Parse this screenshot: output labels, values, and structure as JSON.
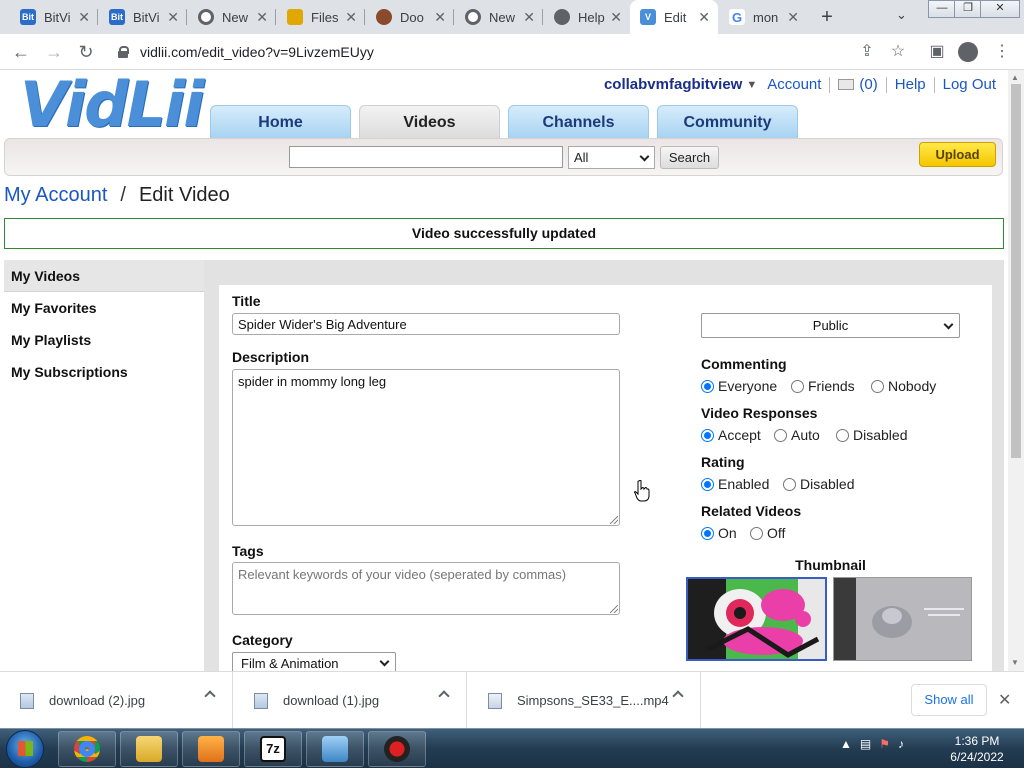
{
  "browser": {
    "tabs": [
      {
        "label": "BitVi",
        "favicon": "bitview-icon",
        "color": "#2a6cc9"
      },
      {
        "label": "BitVi",
        "favicon": "bitview-icon",
        "color": "#2a6cc9"
      },
      {
        "label": "New",
        "favicon": "chrome-icon",
        "color": "#5f6368"
      },
      {
        "label": "Files",
        "favicon": "folder-icon",
        "color": "#e0a800"
      },
      {
        "label": "Doo",
        "favicon": "avatar-icon",
        "color": "#8b4a2b"
      },
      {
        "label": "New",
        "favicon": "chrome-icon",
        "color": "#5f6368"
      },
      {
        "label": "Help",
        "favicon": "globe-icon",
        "color": "#5f6368"
      },
      {
        "label": "Edit",
        "favicon": "vidlii-icon",
        "color": "#4a8fd8",
        "active": true
      },
      {
        "label": "mon",
        "favicon": "google-icon",
        "color": "#4285f4"
      }
    ],
    "url": "vidlii.com/edit_video?v=9LivzemEUyy"
  },
  "site": {
    "logo": "VidLii",
    "user": {
      "username": "collabvmfagbitview",
      "account_label": "Account",
      "inbox_count": "(0)",
      "help_label": "Help",
      "logout_label": "Log Out"
    },
    "nav": [
      {
        "label": "Home"
      },
      {
        "label": "Videos",
        "active": true
      },
      {
        "label": "Channels"
      },
      {
        "label": "Community"
      }
    ],
    "search": {
      "value": "",
      "category": "All",
      "button_label": "Search"
    },
    "upload_label": "Upload"
  },
  "breadcrumb": {
    "root": "My Account",
    "separator": "/",
    "current": "Edit Video"
  },
  "notice": "Video successfully updated",
  "sidebar": {
    "items": [
      {
        "label": "My Videos",
        "active": true
      },
      {
        "label": "My Favorites"
      },
      {
        "label": "My Playlists"
      },
      {
        "label": "My Subscriptions"
      }
    ]
  },
  "form": {
    "title_label": "Title",
    "title_value": "Spider Wider's Big Adventure",
    "description_label": "Description",
    "description_value": "spider in mommy long leg",
    "tags_label": "Tags",
    "tags_placeholder": "Relevant keywords of your video (seperated by commas)",
    "category_label": "Category",
    "category_value": "Film & Animation",
    "privacy_value": "Public",
    "commenting": {
      "label": "Commenting",
      "options": [
        "Everyone",
        "Friends",
        "Nobody"
      ],
      "selected": 0
    },
    "video_responses": {
      "label": "Video Responses",
      "options": [
        "Accept",
        "Auto",
        "Disabled"
      ],
      "selected": 0
    },
    "rating": {
      "label": "Rating",
      "options": [
        "Enabled",
        "Disabled"
      ],
      "selected": 0
    },
    "related_videos": {
      "label": "Related Videos",
      "options": [
        "On",
        "Off"
      ],
      "selected": 0
    },
    "thumbnail_label": "Thumbnail"
  },
  "downloads": {
    "items": [
      {
        "name": "download (2).jpg",
        "type": "image"
      },
      {
        "name": "download (1).jpg",
        "type": "image"
      },
      {
        "name": "Simpsons_SE33_E....mp4",
        "type": "video"
      }
    ],
    "show_all_label": "Show all"
  },
  "taskbar": {
    "time": "1:36 PM",
    "date": "6/24/2022"
  }
}
